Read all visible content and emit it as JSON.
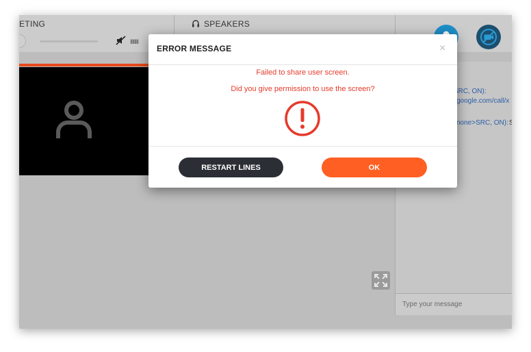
{
  "topbar": {
    "meeting_label": "ETING",
    "speakers_label": "SPEAKERS",
    "level_indicator": "IIIIIIII"
  },
  "chat": {
    "lines": [
      "~SRC, ON):",
      "google.com/call/x",
      "none>SRC, ON):",
      "S"
    ],
    "input_placeholder": "Type your message"
  },
  "modal": {
    "title": "ERROR MESSAGE",
    "close": "×",
    "message_line1": "Failed to share user screen.",
    "message_line2": "Did you give permission to use the screen?",
    "restart_label": "RESTART LINES",
    "ok_label": "OK"
  },
  "colors": {
    "accent": "#ff5f22",
    "error": "#e53b2c",
    "dark_button": "#2b2e35"
  }
}
